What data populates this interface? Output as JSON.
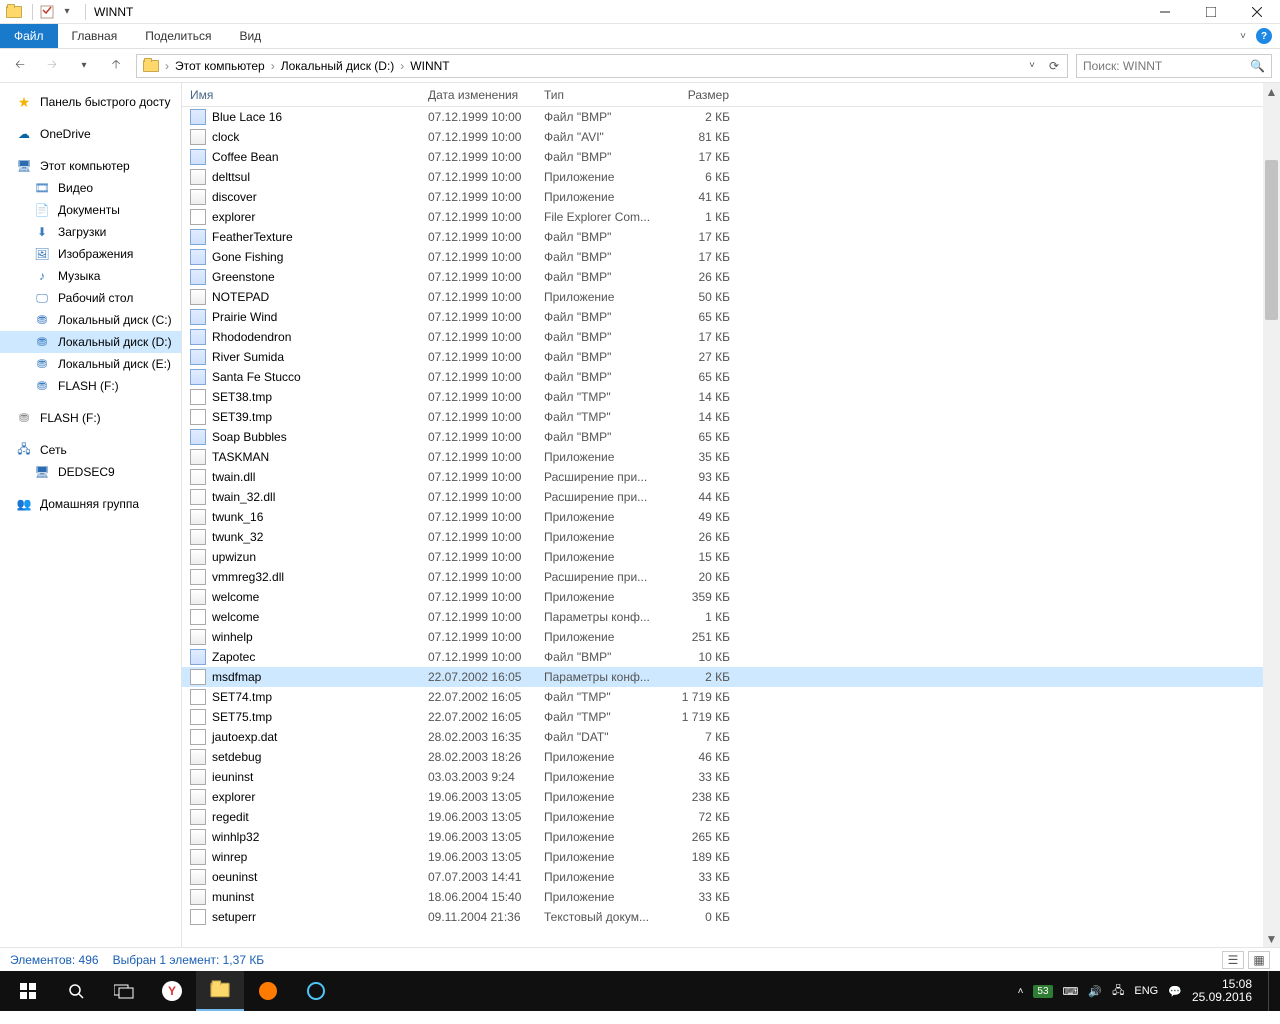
{
  "window": {
    "title": "WINNT"
  },
  "menus": {
    "file": "Файл",
    "home": "Главная",
    "share": "Поделиться",
    "view": "Вид"
  },
  "breadcrumbs": [
    "Этот компьютер",
    "Локальный диск (D:)",
    "WINNT"
  ],
  "search": {
    "placeholder": "Поиск: WINNT"
  },
  "sidebar": {
    "quick": "Панель быстрого досту",
    "onedrive": "OneDrive",
    "thispc": "Этот компьютер",
    "items": [
      {
        "l": "Видео",
        "i": "video"
      },
      {
        "l": "Документы",
        "i": "doc"
      },
      {
        "l": "Загрузки",
        "i": "down"
      },
      {
        "l": "Изображения",
        "i": "img"
      },
      {
        "l": "Музыка",
        "i": "music"
      },
      {
        "l": "Рабочий стол",
        "i": "desk"
      },
      {
        "l": "Локальный диск (C:)",
        "i": "drive"
      },
      {
        "l": "Локальный диск (D:)",
        "i": "drive",
        "sel": true
      },
      {
        "l": "Локальный диск (E:)",
        "i": "drive"
      },
      {
        "l": "FLASH (F:)",
        "i": "drive"
      }
    ],
    "flash2": "FLASH (F:)",
    "network": "Сеть",
    "dedsec": "DEDSEC9",
    "homegroup": "Домашняя группа"
  },
  "columns": {
    "name": "Имя",
    "date": "Дата изменения",
    "type": "Тип",
    "size": "Размер"
  },
  "files": [
    {
      "n": "Blue Lace 16",
      "d": "07.12.1999 10:00",
      "t": "Файл \"BMP\"",
      "s": "2 КБ",
      "i": "bmp"
    },
    {
      "n": "clock",
      "d": "07.12.1999 10:00",
      "t": "Файл \"AVI\"",
      "s": "81 КБ",
      "i": "app"
    },
    {
      "n": "Coffee Bean",
      "d": "07.12.1999 10:00",
      "t": "Файл \"BMP\"",
      "s": "17 КБ",
      "i": "bmp"
    },
    {
      "n": "delttsul",
      "d": "07.12.1999 10:00",
      "t": "Приложение",
      "s": "6 КБ",
      "i": "app"
    },
    {
      "n": "discover",
      "d": "07.12.1999 10:00",
      "t": "Приложение",
      "s": "41 КБ",
      "i": "app"
    },
    {
      "n": "explorer",
      "d": "07.12.1999 10:00",
      "t": "File Explorer Com...",
      "s": "1 КБ",
      "i": "txt"
    },
    {
      "n": "FeatherTexture",
      "d": "07.12.1999 10:00",
      "t": "Файл \"BMP\"",
      "s": "17 КБ",
      "i": "bmp"
    },
    {
      "n": "Gone Fishing",
      "d": "07.12.1999 10:00",
      "t": "Файл \"BMP\"",
      "s": "17 КБ",
      "i": "bmp"
    },
    {
      "n": "Greenstone",
      "d": "07.12.1999 10:00",
      "t": "Файл \"BMP\"",
      "s": "26 КБ",
      "i": "bmp"
    },
    {
      "n": "NOTEPAD",
      "d": "07.12.1999 10:00",
      "t": "Приложение",
      "s": "50 КБ",
      "i": "app"
    },
    {
      "n": "Prairie Wind",
      "d": "07.12.1999 10:00",
      "t": "Файл \"BMP\"",
      "s": "65 КБ",
      "i": "bmp"
    },
    {
      "n": "Rhododendron",
      "d": "07.12.1999 10:00",
      "t": "Файл \"BMP\"",
      "s": "17 КБ",
      "i": "bmp"
    },
    {
      "n": "River Sumida",
      "d": "07.12.1999 10:00",
      "t": "Файл \"BMP\"",
      "s": "27 КБ",
      "i": "bmp"
    },
    {
      "n": "Santa Fe Stucco",
      "d": "07.12.1999 10:00",
      "t": "Файл \"BMP\"",
      "s": "65 КБ",
      "i": "bmp"
    },
    {
      "n": "SET38.tmp",
      "d": "07.12.1999 10:00",
      "t": "Файл \"TMP\"",
      "s": "14 КБ",
      "i": "txt"
    },
    {
      "n": "SET39.tmp",
      "d": "07.12.1999 10:00",
      "t": "Файл \"TMP\"",
      "s": "14 КБ",
      "i": "txt"
    },
    {
      "n": "Soap Bubbles",
      "d": "07.12.1999 10:00",
      "t": "Файл \"BMP\"",
      "s": "65 КБ",
      "i": "bmp"
    },
    {
      "n": "TASKMAN",
      "d": "07.12.1999 10:00",
      "t": "Приложение",
      "s": "35 КБ",
      "i": "app"
    },
    {
      "n": "twain.dll",
      "d": "07.12.1999 10:00",
      "t": "Расширение при...",
      "s": "93 КБ",
      "i": "dll"
    },
    {
      "n": "twain_32.dll",
      "d": "07.12.1999 10:00",
      "t": "Расширение при...",
      "s": "44 КБ",
      "i": "dll"
    },
    {
      "n": "twunk_16",
      "d": "07.12.1999 10:00",
      "t": "Приложение",
      "s": "49 КБ",
      "i": "app"
    },
    {
      "n": "twunk_32",
      "d": "07.12.1999 10:00",
      "t": "Приложение",
      "s": "26 КБ",
      "i": "app"
    },
    {
      "n": "upwizun",
      "d": "07.12.1999 10:00",
      "t": "Приложение",
      "s": "15 КБ",
      "i": "app"
    },
    {
      "n": "vmmreg32.dll",
      "d": "07.12.1999 10:00",
      "t": "Расширение при...",
      "s": "20 КБ",
      "i": "dll"
    },
    {
      "n": "welcome",
      "d": "07.12.1999 10:00",
      "t": "Приложение",
      "s": "359 КБ",
      "i": "app"
    },
    {
      "n": "welcome",
      "d": "07.12.1999 10:00",
      "t": "Параметры конф...",
      "s": "1 КБ",
      "i": "txt"
    },
    {
      "n": "winhelp",
      "d": "07.12.1999 10:00",
      "t": "Приложение",
      "s": "251 КБ",
      "i": "app"
    },
    {
      "n": "Zapotec",
      "d": "07.12.1999 10:00",
      "t": "Файл \"BMP\"",
      "s": "10 КБ",
      "i": "bmp"
    },
    {
      "n": "msdfmap",
      "d": "22.07.2002 16:05",
      "t": "Параметры конф...",
      "s": "2 КБ",
      "i": "txt",
      "sel": true
    },
    {
      "n": "SET74.tmp",
      "d": "22.07.2002 16:05",
      "t": "Файл \"TMP\"",
      "s": "1 719 КБ",
      "i": "txt"
    },
    {
      "n": "SET75.tmp",
      "d": "22.07.2002 16:05",
      "t": "Файл \"TMP\"",
      "s": "1 719 КБ",
      "i": "txt"
    },
    {
      "n": "jautoexp.dat",
      "d": "28.02.2003 16:35",
      "t": "Файл \"DAT\"",
      "s": "7 КБ",
      "i": "txt"
    },
    {
      "n": "setdebug",
      "d": "28.02.2003 18:26",
      "t": "Приложение",
      "s": "46 КБ",
      "i": "app"
    },
    {
      "n": "ieuninst",
      "d": "03.03.2003 9:24",
      "t": "Приложение",
      "s": "33 КБ",
      "i": "app"
    },
    {
      "n": "explorer",
      "d": "19.06.2003 13:05",
      "t": "Приложение",
      "s": "238 КБ",
      "i": "app"
    },
    {
      "n": "regedit",
      "d": "19.06.2003 13:05",
      "t": "Приложение",
      "s": "72 КБ",
      "i": "app"
    },
    {
      "n": "winhlp32",
      "d": "19.06.2003 13:05",
      "t": "Приложение",
      "s": "265 КБ",
      "i": "app"
    },
    {
      "n": "winrep",
      "d": "19.06.2003 13:05",
      "t": "Приложение",
      "s": "189 КБ",
      "i": "app"
    },
    {
      "n": "oeuninst",
      "d": "07.07.2003 14:41",
      "t": "Приложение",
      "s": "33 КБ",
      "i": "app"
    },
    {
      "n": "muninst",
      "d": "18.06.2004 15:40",
      "t": "Приложение",
      "s": "33 КБ",
      "i": "app"
    },
    {
      "n": "setuperr",
      "d": "09.11.2004 21:36",
      "t": "Текстовый докум...",
      "s": "0 КБ",
      "i": "txt"
    }
  ],
  "status": {
    "count": "Элементов: 496",
    "sel": "Выбран 1 элемент: 1,37 КБ"
  },
  "tray": {
    "badge": "53",
    "lang": "ENG",
    "time": "15:08",
    "date": "25.09.2016"
  }
}
